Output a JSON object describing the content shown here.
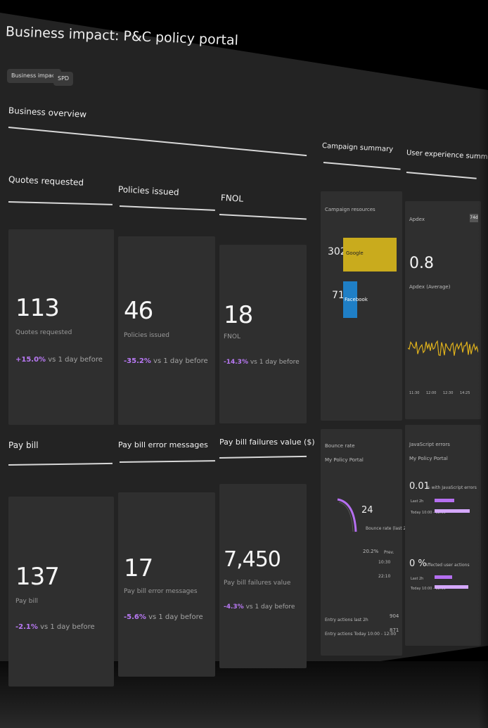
{
  "page": {
    "title": "Business impact: P&C policy portal",
    "tags": [
      "Business impact",
      "SPD"
    ]
  },
  "sections": {
    "business_overview": "Business overview",
    "campaign_summary": "Campaign summary",
    "user_experience_summary": "User experience summary"
  },
  "kpis": [
    {
      "header": "Quotes requested",
      "value": "113",
      "sub": "Quotes requested",
      "delta": "+15.0%",
      "delta_suffix": " vs 1 day before"
    },
    {
      "header": "Policies issued",
      "value": "46",
      "sub": "Policies issued",
      "delta": "-35.2%",
      "delta_suffix": " vs 1 day before"
    },
    {
      "header": "FNOL",
      "value": "18",
      "sub": "FNOL",
      "delta": "-14.3%",
      "delta_suffix": " vs 1 day before"
    },
    {
      "header": "Pay bill",
      "value": "137",
      "sub": "Pay bill",
      "delta": "-2.1%",
      "delta_suffix": " vs 1 day before"
    },
    {
      "header": "Pay bill error messages",
      "value": "17",
      "sub": "Pay bill error messages",
      "delta": "-5.6%",
      "delta_suffix": " vs 1 day before"
    },
    {
      "header": "Pay bill failures value ($)",
      "value": "7,450",
      "sub": "Pay bill failures value",
      "delta": "-4.3%",
      "delta_suffix": " vs 1 day before"
    }
  ],
  "campaign": {
    "title": "Campaign resources",
    "rows": [
      {
        "value": "302",
        "label": "Google",
        "color": "#c9ab1d",
        "fraction": 1.0
      },
      {
        "value": "71",
        "label": "Facebook",
        "color": "#1f7fc6",
        "fraction": 0.24
      }
    ]
  },
  "apdex": {
    "title": "Apdex",
    "badge": "74d",
    "value": "0.8",
    "sub": "Apdex (Average)",
    "axis_ticks": [
      "11:30",
      "12:00",
      "12:30",
      "14:25"
    ],
    "line_color": "#e0b21c"
  },
  "bounce": {
    "title": "Bounce rate",
    "subtitle": "My Policy Portal",
    "value": "24",
    "value_caption": "Bounce rate (last 2h)",
    "rate": "20.2%",
    "rate_caption": "Prev.",
    "rate_lines": [
      "10:30",
      "22:10"
    ],
    "entry_actions_label": "Entry actions last 2h",
    "entry_actions_value": "904",
    "entry_actions_today_label": "Entry actions Today 10:00 - 12:00",
    "entry_actions_today_value": "871"
  },
  "js_errors": {
    "title": "JavaScript errors",
    "subtitle": "My Policy Portal",
    "block1": {
      "value": "0.01",
      "caption": "% with JavaScript errors",
      "row1": "Last 2h",
      "row2": "Today 10:00 - 12:00",
      "bar1_fraction": 0.5,
      "bar2_fraction": 0.9
    },
    "block2": {
      "value": "0 %",
      "caption": "Affected user actions",
      "row1": "Last 2h",
      "row2": "Today 10:00 - 12:00",
      "bar1_fraction": 0.45,
      "bar2_fraction": 0.85
    },
    "bar_color": "#b56ff0",
    "bar2_color": "#d5a8ff"
  }
}
